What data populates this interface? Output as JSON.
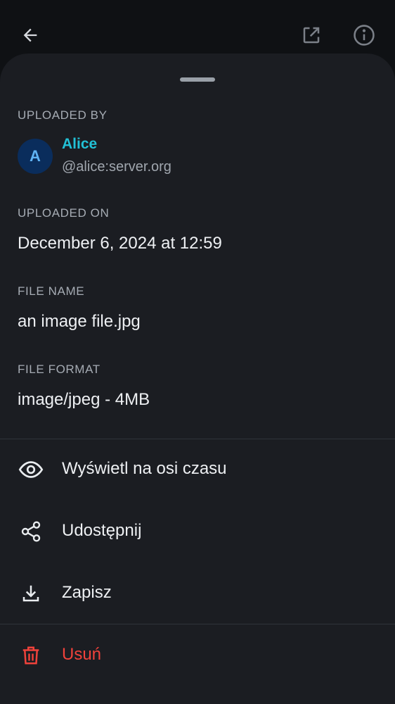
{
  "topbar": {
    "back_icon": "arrow-back-icon",
    "open_external_icon": "open-external-icon",
    "info_icon": "info-icon"
  },
  "sheet": {
    "uploaded_by": {
      "label": "UPLOADED BY",
      "avatar_initial": "A",
      "name": "Alice",
      "user_id": "@alice:server.org"
    },
    "uploaded_on": {
      "label": "UPLOADED ON",
      "value": "December 6, 2024 at 12:59"
    },
    "file_name": {
      "label": "FILE NAME",
      "value": "an image file.jpg"
    },
    "file_format": {
      "label": "FILE FORMAT",
      "value": "image/jpeg - 4MB"
    },
    "actions": [
      {
        "label": "Wyświetl na osi czasu",
        "icon": "eye-icon"
      },
      {
        "label": "Udostępnij",
        "icon": "share-icon"
      },
      {
        "label": "Zapisz",
        "icon": "download-icon"
      },
      {
        "label": "Usuń",
        "icon": "trash-icon"
      }
    ]
  },
  "colors": {
    "accent_name": "#22c1d6",
    "danger": "#f0423b",
    "sheet_bg": "#1b1d22"
  }
}
